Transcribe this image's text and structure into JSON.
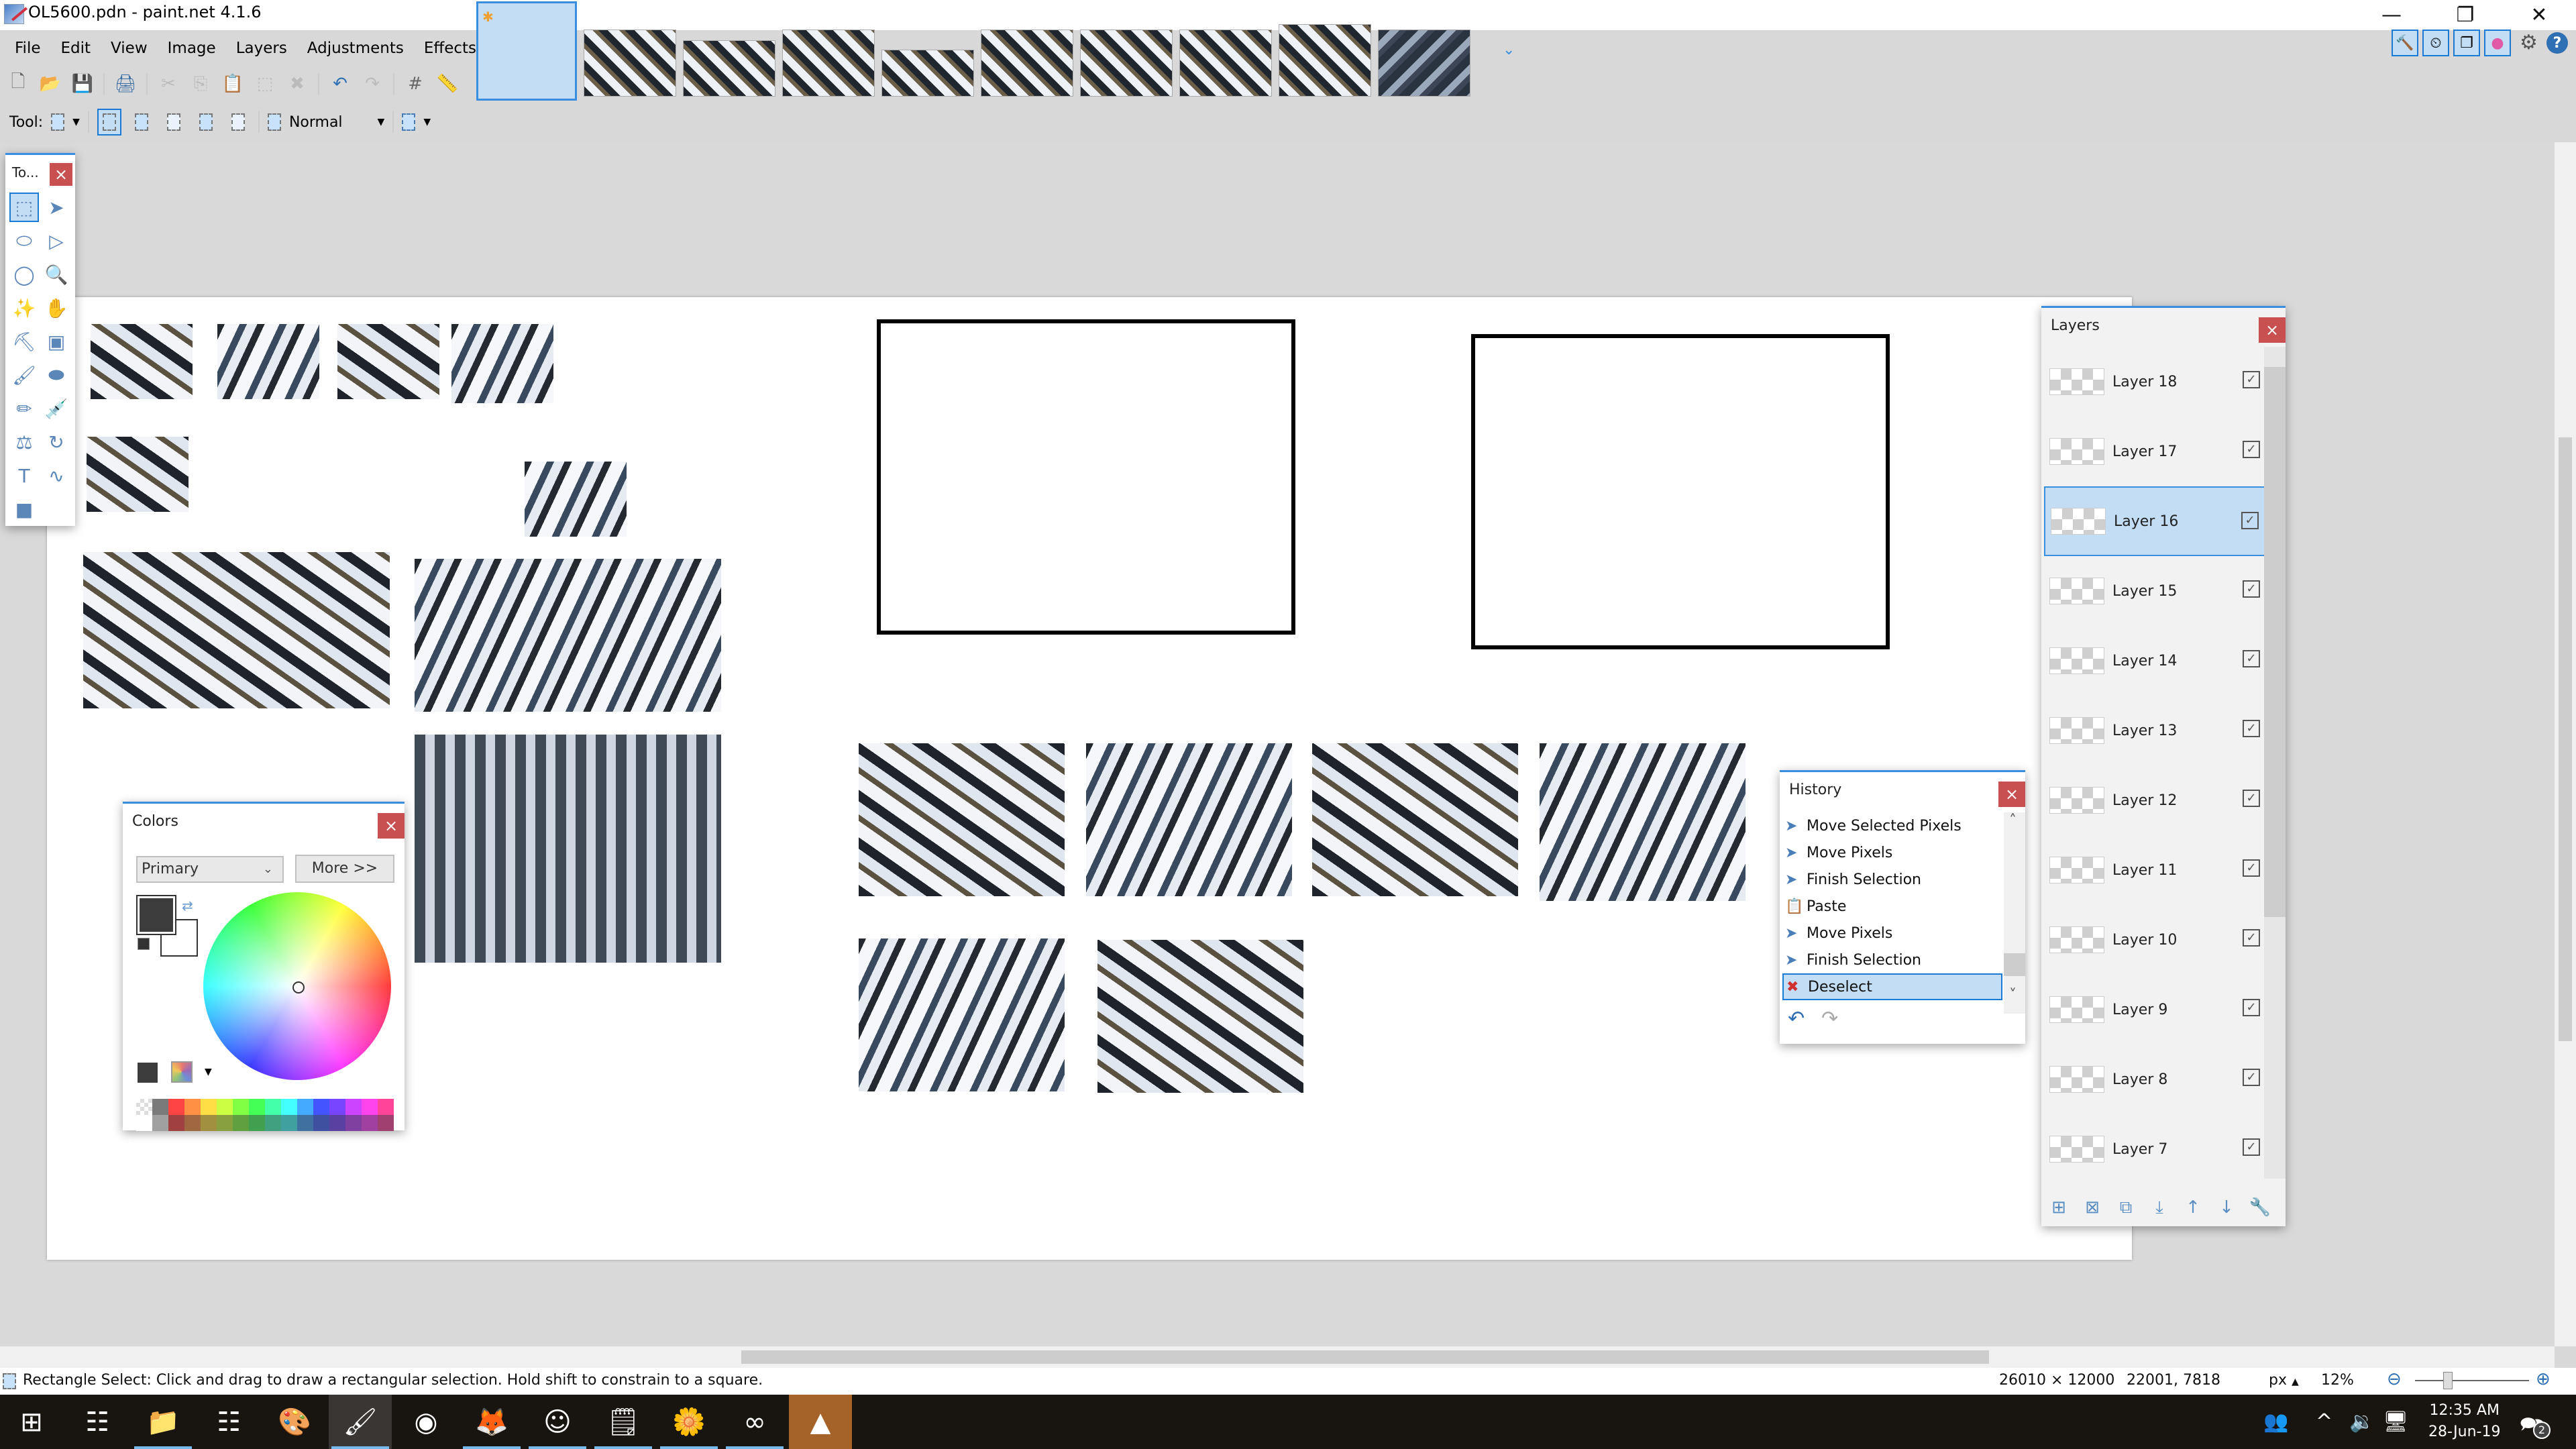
{
  "window": {
    "title": "OL5600.pdn - paint.net 4.1.6",
    "minimize_label": "—",
    "restore_label": "❐",
    "close_label": "✕"
  },
  "menu": [
    "File",
    "Edit",
    "View",
    "Image",
    "Layers",
    "Adjustments",
    "Effects"
  ],
  "top_right_panels": {
    "tools_icon": "🔨",
    "history_icon": "⏲",
    "layers_icon": "❐",
    "colors_icon": "●",
    "settings_icon": "⚙",
    "help_label": "?"
  },
  "document_thumbnails_count": 10,
  "toolbar": {
    "icons": [
      "new-file",
      "open-file",
      "save",
      "print",
      "cut",
      "copy",
      "paste",
      "crop-to-selection",
      "deselect",
      "undo",
      "redo",
      "grid",
      "ruler"
    ],
    "glyphs": [
      "🗋",
      "📂",
      "💾",
      "🖨",
      "✂",
      "⎘",
      "📋",
      "⬚",
      "✖",
      "↶",
      "↷",
      "#",
      "📏"
    ]
  },
  "tool_options": {
    "tool_label": "Tool:",
    "blend_mode": "Normal",
    "dropdown_glyph": "▼"
  },
  "tools_panel": {
    "title": "To...",
    "close": "×",
    "tools": [
      {
        "name": "rectangle-select",
        "glyph": "⬚"
      },
      {
        "name": "move-selected-pixels",
        "glyph": "➤"
      },
      {
        "name": "lasso-select",
        "glyph": "⬭"
      },
      {
        "name": "move-selection",
        "glyph": "▷"
      },
      {
        "name": "ellipse-select",
        "glyph": "◯"
      },
      {
        "name": "zoom",
        "glyph": "🔍"
      },
      {
        "name": "magic-wand",
        "glyph": "✨"
      },
      {
        "name": "pan",
        "glyph": "✋"
      },
      {
        "name": "paint-bucket",
        "glyph": "⛏"
      },
      {
        "name": "gradient",
        "glyph": "▣"
      },
      {
        "name": "paintbrush",
        "glyph": "🖌"
      },
      {
        "name": "eraser",
        "glyph": "⬬"
      },
      {
        "name": "pencil",
        "glyph": "✏"
      },
      {
        "name": "color-picker",
        "glyph": "💉"
      },
      {
        "name": "clone-stamp",
        "glyph": "⚖"
      },
      {
        "name": "recolor",
        "glyph": "↻"
      },
      {
        "name": "text",
        "glyph": "T"
      },
      {
        "name": "line-curve",
        "glyph": "∿"
      },
      {
        "name": "shapes",
        "glyph": "■"
      }
    ]
  },
  "colors_panel": {
    "title": "Colors",
    "close": "×",
    "selector": "Primary",
    "selector_chevron": "⌄",
    "more_button": "More >>",
    "primary_color": "#3c3c3c",
    "secondary_color": "#ffffff",
    "swap_glyph": "⇄",
    "palette_dropdown": "▼",
    "palette_top": [
      "#7a7a7a",
      "#ff4444",
      "#ff9044",
      "#ffdd44",
      "#ccff44",
      "#80ff44",
      "#44ff55",
      "#44ffaa",
      "#44ffff",
      "#44aaff",
      "#4455ff",
      "#7744ff",
      "#cc44ff",
      "#ff44ee",
      "#ff4499"
    ],
    "palette_bottom": [
      "#a0a0a0",
      "#a04040",
      "#a06840",
      "#a09040",
      "#88a040",
      "#60a040",
      "#40a050",
      "#40a080",
      "#40a0a0",
      "#4070a0",
      "#4050a0",
      "#5a40a0",
      "#8040a0",
      "#a040a0",
      "#a04070"
    ]
  },
  "history_panel": {
    "title": "History",
    "close": "×",
    "items": [
      {
        "label": "Move Selected Pixels",
        "icon": "➤"
      },
      {
        "label": "Move Pixels",
        "icon": "➤"
      },
      {
        "label": "Finish Selection",
        "icon": "➤"
      },
      {
        "label": "Paste",
        "icon": "📋"
      },
      {
        "label": "Move Pixels",
        "icon": "➤"
      },
      {
        "label": "Finish Selection",
        "icon": "➤"
      },
      {
        "label": "Deselect",
        "icon": "✖"
      }
    ],
    "selected_index": 6,
    "scroll_up": "˄",
    "scroll_down": "˅",
    "undo_glyph": "↶",
    "redo_glyph": "↷"
  },
  "layers_panel": {
    "title": "Layers",
    "close": "×",
    "layers": [
      {
        "name": "Layer 18",
        "visible": true
      },
      {
        "name": "Layer 17",
        "visible": true
      },
      {
        "name": "Layer 16",
        "visible": true
      },
      {
        "name": "Layer 15",
        "visible": true
      },
      {
        "name": "Layer 14",
        "visible": true
      },
      {
        "name": "Layer 13",
        "visible": true
      },
      {
        "name": "Layer 12",
        "visible": true
      },
      {
        "name": "Layer 11",
        "visible": true
      },
      {
        "name": "Layer 10",
        "visible": true
      },
      {
        "name": "Layer 9",
        "visible": true
      },
      {
        "name": "Layer 8",
        "visible": true
      },
      {
        "name": "Layer 7",
        "visible": true
      }
    ],
    "selected_index": 2,
    "check_glyph": "✓",
    "actions": [
      {
        "name": "add-layer",
        "glyph": "⊞"
      },
      {
        "name": "delete-layer",
        "glyph": "⊠"
      },
      {
        "name": "duplicate-layer",
        "glyph": "⧉"
      },
      {
        "name": "merge-layer-down",
        "glyph": "⤓"
      },
      {
        "name": "move-layer-up",
        "glyph": "↑"
      },
      {
        "name": "move-layer-down",
        "glyph": "↓"
      },
      {
        "name": "layer-properties",
        "glyph": "🔧"
      }
    ]
  },
  "status": {
    "hint": "Rectangle Select: Click and drag to draw a rectangular selection. Hold shift to constrain to a square.",
    "image_size": "26010 × 12000",
    "cursor_position": "22001, 7818",
    "units": "px",
    "units_arrow": "▲",
    "zoom": "12%",
    "zoom_out_glyph": "⊖",
    "zoom_in_glyph": "⊕"
  },
  "taskbar": {
    "apps": [
      {
        "name": "start",
        "glyph": "⊞"
      },
      {
        "name": "task-view",
        "glyph": "☷"
      },
      {
        "name": "file-explorer",
        "glyph": "📁"
      },
      {
        "name": "calculator",
        "glyph": "☷"
      },
      {
        "name": "paint",
        "glyph": "🎨"
      },
      {
        "name": "paint-net",
        "glyph": "🖌"
      },
      {
        "name": "chrome",
        "glyph": "◉"
      },
      {
        "name": "firefox",
        "glyph": "🦊"
      },
      {
        "name": "discord",
        "glyph": "☺"
      },
      {
        "name": "notepad",
        "glyph": "🗒"
      },
      {
        "name": "photo-viewer",
        "glyph": "🌼"
      },
      {
        "name": "app-infinity",
        "glyph": "∞"
      },
      {
        "name": "vlc",
        "glyph": "▲"
      }
    ],
    "tray_people": "👥",
    "tray_chevron": "^",
    "tray_volume": "🔉",
    "tray_network": "🖥",
    "time": "12:35 AM",
    "date": "28-Jun-19",
    "notification_glyph": "🗪",
    "notification_count": "2"
  }
}
